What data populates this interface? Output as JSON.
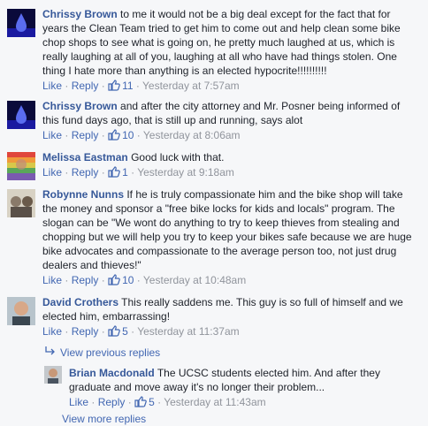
{
  "actions": {
    "like": "Like",
    "reply": "Reply"
  },
  "comments": [
    {
      "author": "Chrissy Brown",
      "text": "to me it would not be a big deal except for the fact that for years the Clean Team tried to get him to come out and help clean some bike chop shops to see what is going on, he pretty much laughed at us, which is really laughing at all of you, laughing at all who have had things stolen. One thing I hate more than anything is an elected hypocrite!!!!!!!!!!",
      "likes": "11",
      "time": "Yesterday at 7:57am"
    },
    {
      "author": "Chrissy Brown",
      "text": "and after the city attorney and Mr. Posner being informed of this fund days ago, that is still up and running, says alot",
      "likes": "10",
      "time": "Yesterday at 8:06am"
    },
    {
      "author": "Melissa Eastman",
      "text": "Good luck with that.",
      "likes": "1",
      "time": "Yesterday at 9:18am"
    },
    {
      "author": "Robynne Nunns",
      "text": "If he is truly compassionate him and the bike shop will take the money and sponsor a \"free bike locks for kids and locals\" program. The slogan can be \"We wont do anything to try to keep thieves from stealing and chopping but we will help you try to keep your bikes safe because we are huge bike advocates and compassionate to the average person too, not just drug dealers and thieves!\"",
      "likes": "10",
      "time": "Yesterday at 10:48am"
    },
    {
      "author": "David Crothers",
      "text": "This really saddens me. This guy is so full of himself and we elected him, embarrassing!",
      "likes": "5",
      "time": "Yesterday at 11:37am"
    }
  ],
  "view_previous": "View previous replies",
  "reply": {
    "author": "Brian Macdonald",
    "text": "The UCSC students elected him. And after they graduate and move away it's no longer their problem...",
    "likes": "5",
    "time": "Yesterday at 11:43am"
  },
  "view_more": "View more replies",
  "colors": {
    "link": "#4267b2",
    "author": "#365899",
    "meta": "#90949c",
    "background": "#f6f7f9"
  }
}
